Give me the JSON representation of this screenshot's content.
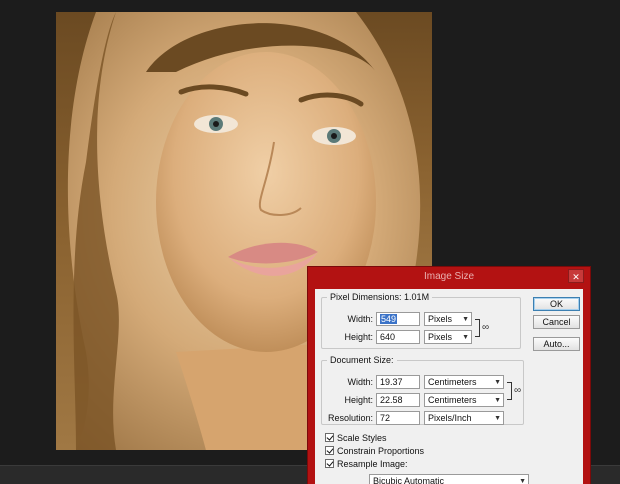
{
  "dialog": {
    "title": "Image Size",
    "close_icon": "close-icon"
  },
  "pixel_dimensions": {
    "legend": "Pixel Dimensions:",
    "size": "1.01M",
    "width_label": "Width:",
    "width_value": "549",
    "width_unit": "Pixels",
    "height_label": "Height:",
    "height_value": "640",
    "height_unit": "Pixels",
    "link_icon": "chain-link-icon"
  },
  "document_size": {
    "legend": "Document Size:",
    "width_label": "Width:",
    "width_value": "19.37",
    "width_unit": "Centimeters",
    "height_label": "Height:",
    "height_value": "22.58",
    "height_unit": "Centimeters",
    "resolution_label": "Resolution:",
    "resolution_value": "72",
    "resolution_unit": "Pixels/Inch",
    "link_icon": "chain-link-icon"
  },
  "buttons": {
    "ok": "OK",
    "cancel": "Cancel",
    "auto": "Auto..."
  },
  "options": {
    "scale_styles": "Scale Styles",
    "scale_styles_checked": true,
    "constrain_proportions": "Constrain Proportions",
    "constrain_proportions_checked": true,
    "resample_image": "Resample Image:",
    "resample_image_checked": true,
    "resample_method": "Bicubic Automatic"
  },
  "colors": {
    "dialog_frame": "#b31212",
    "workspace": "#1c1c1c",
    "selection": "#3b73c8"
  }
}
